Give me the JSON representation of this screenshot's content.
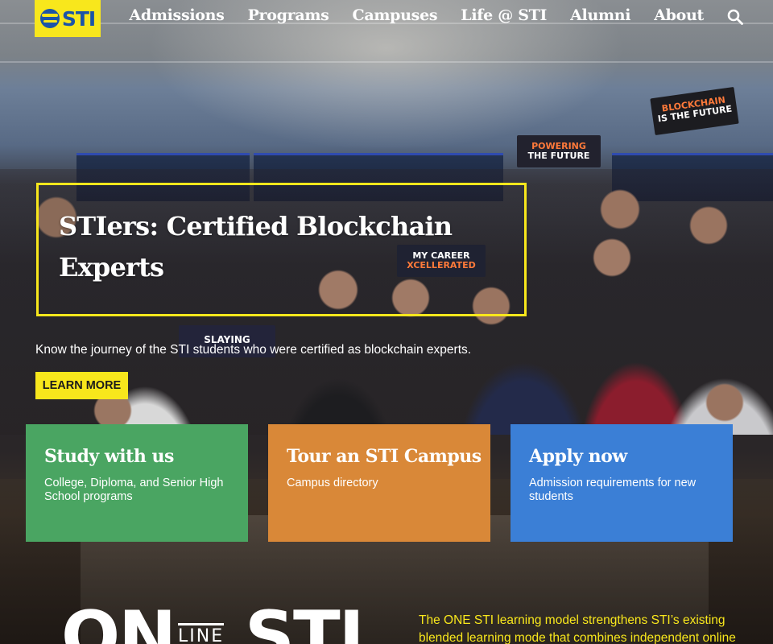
{
  "header": {
    "logo_text": "STI",
    "nav": [
      {
        "label": "Admissions"
      },
      {
        "label": "Programs"
      },
      {
        "label": "Campuses"
      },
      {
        "label": "Life @ STI"
      },
      {
        "label": "Alumni"
      },
      {
        "label": "About"
      }
    ],
    "search_icon": "search-icon"
  },
  "hero_signs": {
    "blockchain": [
      "BLOCKCHAIN",
      "IS THE FUTURE"
    ],
    "powering": [
      "POWERING",
      "THE FUTURE"
    ],
    "career": [
      "MY CAREER",
      "XCELLERATED"
    ],
    "slaying": "SLAYING"
  },
  "featured": {
    "headline": "STIers: Certified Blockchain Experts",
    "lede": "Know the journey of the STI students who were certified as blockchain experts.",
    "cta": "LEARN MORE"
  },
  "cards": [
    {
      "title": "Study with us",
      "desc": "College, Diploma, and Senior High School programs",
      "color": "#4aa562"
    },
    {
      "title": "Tour an STI Campus",
      "desc": "Campus directory",
      "color": "#d98838"
    },
    {
      "title": "Apply now",
      "desc": "Admission requirements for new students",
      "color": "#3b7fd6"
    }
  ],
  "one_sti": {
    "logo_left": "ON",
    "logo_line": "LINE",
    "logo_right": "STI",
    "description": "The ONE STI learning model strengthens STI’s existing blended learning mode that combines independent online"
  },
  "colors": {
    "accent": "#f8e71c",
    "brand_blue": "#1b54a8"
  }
}
